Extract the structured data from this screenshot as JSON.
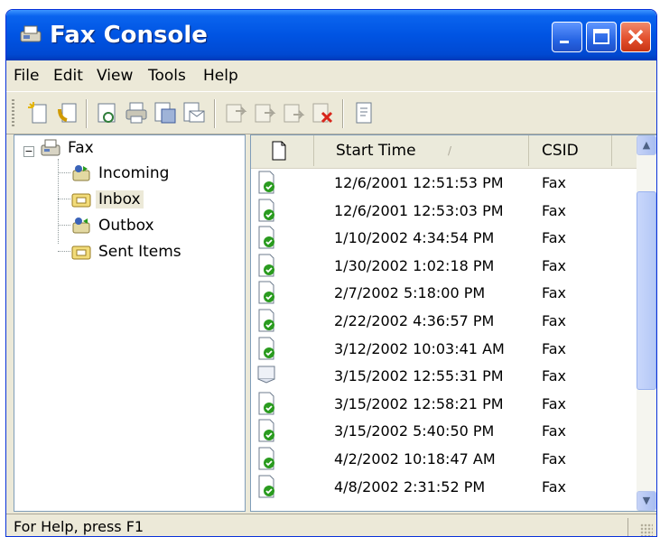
{
  "window": {
    "title": "Fax Console"
  },
  "menu": [
    "File",
    "Edit",
    "View",
    "Tools",
    "Help"
  ],
  "toolbar": {
    "buttons": [
      "new-fax-icon",
      "receive-fax-icon",
      "view-icon",
      "print-icon",
      "save-as-icon",
      "email-icon",
      "pause-icon",
      "resume-icon",
      "restart-icon",
      "delete-icon",
      "properties-icon"
    ]
  },
  "tree": {
    "root": "Fax",
    "items": [
      "Incoming",
      "Inbox",
      "Outbox",
      "Sent Items"
    ],
    "selected": "Inbox"
  },
  "list": {
    "columns": [
      "Start Time",
      "CSID"
    ],
    "rows": [
      {
        "start_time": "12/6/2001 12:51:53 PM",
        "csid": "Fax",
        "read": false
      },
      {
        "start_time": "12/6/2001 12:53:03 PM",
        "csid": "Fax",
        "read": false
      },
      {
        "start_time": "1/10/2002 4:34:54 PM",
        "csid": "Fax",
        "read": false
      },
      {
        "start_time": "1/30/2002 1:02:18 PM",
        "csid": "Fax",
        "read": false
      },
      {
        "start_time": "2/7/2002 5:18:00 PM",
        "csid": "Fax",
        "read": false
      },
      {
        "start_time": "2/22/2002 4:36:57 PM",
        "csid": "Fax",
        "read": false
      },
      {
        "start_time": "3/12/2002 10:03:41 AM",
        "csid": "Fax",
        "read": false
      },
      {
        "start_time": "3/15/2002 12:55:31 PM",
        "csid": "Fax",
        "read": true
      },
      {
        "start_time": "3/15/2002 12:58:21 PM",
        "csid": "Fax",
        "read": false
      },
      {
        "start_time": "3/15/2002 5:40:50 PM",
        "csid": "Fax",
        "read": false
      },
      {
        "start_time": "4/2/2002 10:18:47 AM",
        "csid": "Fax",
        "read": false
      },
      {
        "start_time": "4/8/2002 2:31:52 PM",
        "csid": "Fax",
        "read": false
      }
    ]
  },
  "status": {
    "text": "For Help, press F1"
  },
  "colors": {
    "titlebar": "#0054e3",
    "face": "#ece9d8",
    "check_green": "#2a9b1f"
  }
}
